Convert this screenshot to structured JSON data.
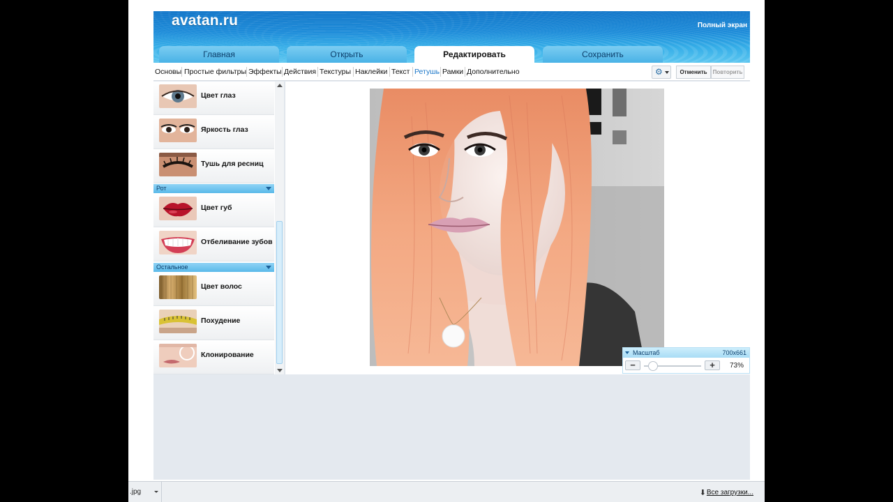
{
  "app": {
    "logo": "avatan.ru",
    "fullscreen_label": "Полный экран"
  },
  "tabs": [
    {
      "label": "Главная",
      "active": false
    },
    {
      "label": "Открыть",
      "active": false
    },
    {
      "label": "Редактировать",
      "active": true
    },
    {
      "label": "Сохранить",
      "active": false
    }
  ],
  "toolbar": {
    "items": [
      "Основы",
      "Простые фильтры",
      "Эффекты",
      "Действия",
      "Текстуры",
      "Наклейки",
      "Текст",
      "Ретушь",
      "Рамки",
      "Дополнительно"
    ],
    "active_item": "Ретушь",
    "settings_icon": "gear-icon",
    "undo_label": "Отменить",
    "redo_label": "Повторить"
  },
  "panel": {
    "items": [
      {
        "label": "Цвет глаз",
        "icon": "eye-color-thumb"
      },
      {
        "label": "Яркость глаз",
        "icon": "eye-brightness-thumb"
      },
      {
        "label": "Тушь для ресниц",
        "icon": "mascara-thumb"
      },
      {
        "label": "Цвет губ",
        "icon": "lip-color-thumb"
      },
      {
        "label": "Отбеливание зубов",
        "icon": "teeth-whitening-thumb"
      },
      {
        "label": "Цвет волос",
        "icon": "hair-color-thumb"
      },
      {
        "label": "Похудение",
        "icon": "slimming-thumb"
      },
      {
        "label": "Клонирование",
        "icon": "clone-thumb"
      }
    ],
    "sections": [
      {
        "label": "Рот"
      },
      {
        "label": "Остальное"
      }
    ]
  },
  "zoom": {
    "title": "Масштаб",
    "image_size": "700x661",
    "percent": "73%",
    "level": 0.73
  },
  "downloads": {
    "file_label": ".jpg",
    "all_label": "Все загрузки..."
  },
  "colors": {
    "accent": "#1a76c8",
    "hair": "#f2a57e"
  }
}
